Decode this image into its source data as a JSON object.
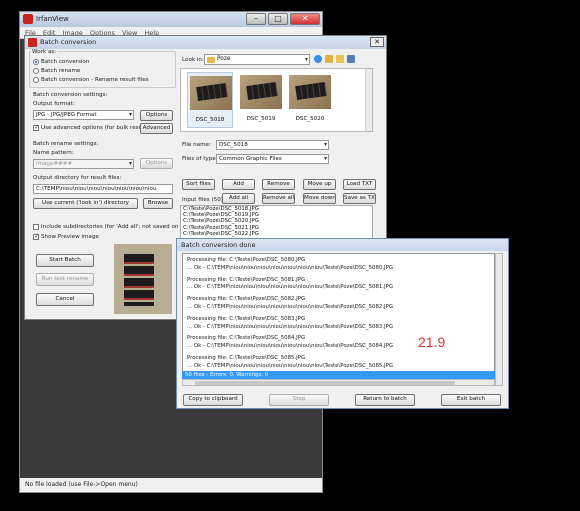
{
  "main_window": {
    "title": "IrfanView",
    "menu": [
      "File",
      "Edit",
      "Image",
      "Options",
      "View",
      "Help"
    ],
    "status": "No file loaded (use File->Open menu)"
  },
  "batch": {
    "title": "Batch conversion",
    "work_as": {
      "label": "Work as:",
      "options": [
        "Batch conversion",
        "Batch rename",
        "Batch conversion - Rename result files"
      ],
      "selected": "Batch conversion"
    },
    "conv_settings_label": "Batch conversion settings:",
    "output_format_label": "Output format:",
    "output_format": "JPG - JPG/JPEG Format",
    "options_btn": "Options",
    "adv_check": "Use advanced options (for bulk resize...)",
    "advanced_btn": "Advanced",
    "rename_settings_label": "Batch rename settings:",
    "name_pattern_label": "Name pattern:",
    "name_pattern": "image####",
    "rename_options_btn": "Options",
    "output_dir_label": "Output directory for result files:",
    "output_dir": "C:\\TEMP\\niou\\niou\\niou\\niou\\niou\\niou\\niou",
    "use_current_btn": "Use current ('look in') directory",
    "browse_btn": "Browse",
    "include_subdirs": "Include subdirectories (for 'Add all'; not saved on exit)",
    "show_preview": "Show Preview image",
    "start_btn": "Start Batch",
    "run_test_btn": "Run test rename",
    "cancel_btn": "Cancel",
    "look_in_label": "Look in:",
    "look_in": "Poze",
    "thumbnails": [
      "DSC_5018",
      "DSC_5019",
      "DSC_5020"
    ],
    "file_name_label": "File name:",
    "file_name": "DSC_5018",
    "files_of_type_label": "Files of type:",
    "files_of_type": "Common Graphic Files",
    "buttons": {
      "sort": "Sort files",
      "add": "Add",
      "remove": "Remove",
      "move_up": "Move up",
      "load_txt": "Load TXT",
      "add_all": "Add all",
      "remove_all": "Remove all",
      "move_down": "Move down",
      "save_txt": "Save as TXT"
    },
    "input_files_label": "Input files (50) :",
    "input_files": [
      "C:\\Teste\\Poze\\DSC_5018.JPG",
      "C:\\Teste\\Poze\\DSC_5019.JPG",
      "C:\\Teste\\Poze\\DSC_5020.JPG",
      "C:\\Teste\\Poze\\DSC_5021.JPG",
      "C:\\Teste\\Poze\\DSC_5022.JPG"
    ]
  },
  "done": {
    "title": "Batch conversion done",
    "log": [
      {
        "p": "Processing file: C:\\Teste\\Poze\\DSC_5080.JPG",
        "o": "... Ok - C:\\TEMP\\niou\\niou\\niou\\niou\\niou\\niou\\niou\\Teste\\Poze\\DSC_5080.JPG"
      },
      {
        "p": "Processing file: C:\\Teste\\Poze\\DSC_5081.JPG",
        "o": "... Ok - C:\\TEMP\\niou\\niou\\niou\\niou\\niou\\niou\\niou\\Teste\\Poze\\DSC_5081.JPG"
      },
      {
        "p": "Processing file: C:\\Teste\\Poze\\DSC_5082.JPG",
        "o": "... Ok - C:\\TEMP\\niou\\niou\\niou\\niou\\niou\\niou\\niou\\Teste\\Poze\\DSC_5082.JPG"
      },
      {
        "p": "Processing file: C:\\Teste\\Poze\\DSC_5083.JPG",
        "o": "... Ok - C:\\TEMP\\niou\\niou\\niou\\niou\\niou\\niou\\niou\\Teste\\Poze\\DSC_5083.JPG"
      },
      {
        "p": "Processing file: C:\\Teste\\Poze\\DSC_5084.JPG",
        "o": "... Ok - C:\\TEMP\\niou\\niou\\niou\\niou\\niou\\niou\\niou\\Teste\\Poze\\DSC_5084.JPG"
      },
      {
        "p": "Processing file: C:\\Teste\\Poze\\DSC_5085.JPG",
        "o": "... Ok - C:\\TEMP\\niou\\niou\\niou\\niou\\niou\\niou\\niou\\Teste\\Poze\\DSC_5085.JPG"
      }
    ],
    "status": "50 files - Errors: 0, Warnings: 0",
    "big_value": "21.9",
    "buttons": {
      "copy": "Copy to clipboard",
      "stop": "Stop",
      "return": "Return to batch",
      "exit": "Exit batch"
    }
  },
  "colors": {
    "accent": "#3399ff",
    "highlight_value": "#e03030",
    "logo": "#c8231c"
  }
}
